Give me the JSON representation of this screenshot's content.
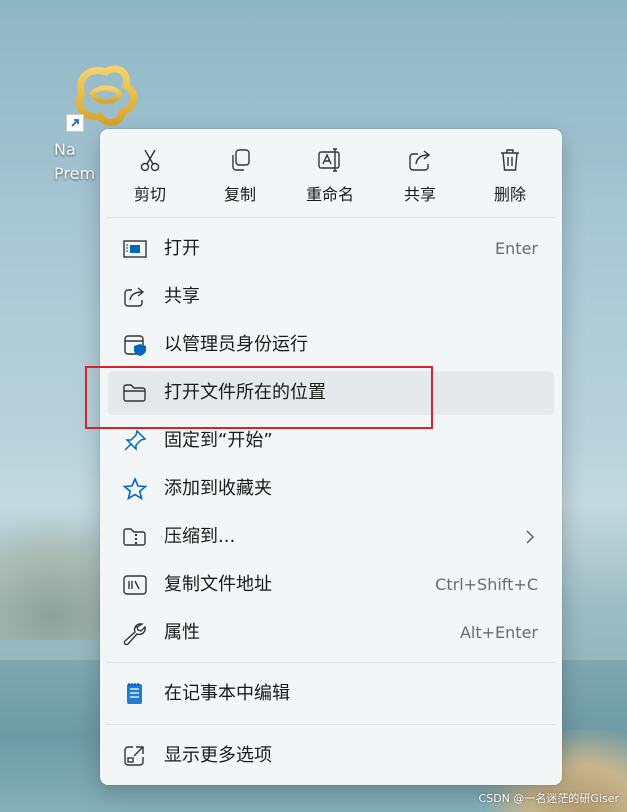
{
  "desktop_icon": {
    "label": "Na\nPrem",
    "icon": "netbeans-logo-icon"
  },
  "quick_actions": [
    {
      "label": "剪切",
      "icon": "cut-icon"
    },
    {
      "label": "复制",
      "icon": "copy-icon"
    },
    {
      "label": "重命名",
      "icon": "rename-icon"
    },
    {
      "label": "共享",
      "icon": "share-icon"
    },
    {
      "label": "删除",
      "icon": "delete-icon"
    }
  ],
  "menu_items": [
    {
      "label": "打开",
      "shortcut": "Enter",
      "icon": "open-icon"
    },
    {
      "label": "共享",
      "shortcut": "",
      "icon": "share-icon"
    },
    {
      "label": "以管理员身份运行",
      "shortcut": "",
      "icon": "run-as-admin-icon"
    },
    {
      "label": "打开文件所在的位置",
      "shortcut": "",
      "icon": "folder-icon"
    },
    {
      "label": "固定到“开始”",
      "shortcut": "",
      "icon": "pin-icon"
    },
    {
      "label": "添加到收藏夹",
      "shortcut": "",
      "icon": "star-icon"
    },
    {
      "label": "压缩到...",
      "shortcut": "",
      "icon": "zip-folder-icon"
    },
    {
      "label": "复制文件地址",
      "shortcut": "Ctrl+Shift+C",
      "icon": "copy-path-icon"
    },
    {
      "label": "属性",
      "shortcut": "Alt+Enter",
      "icon": "wrench-icon"
    }
  ],
  "notepad_item": {
    "label": "在记事本中编辑",
    "icon": "notepad-icon"
  },
  "more_item": {
    "label": "显示更多选项",
    "icon": "more-options-icon"
  },
  "colors": {
    "accent": "#0067c0",
    "highlight_box": "#d8232a"
  },
  "watermark": "CSDN @一名迷茫的研Giser"
}
